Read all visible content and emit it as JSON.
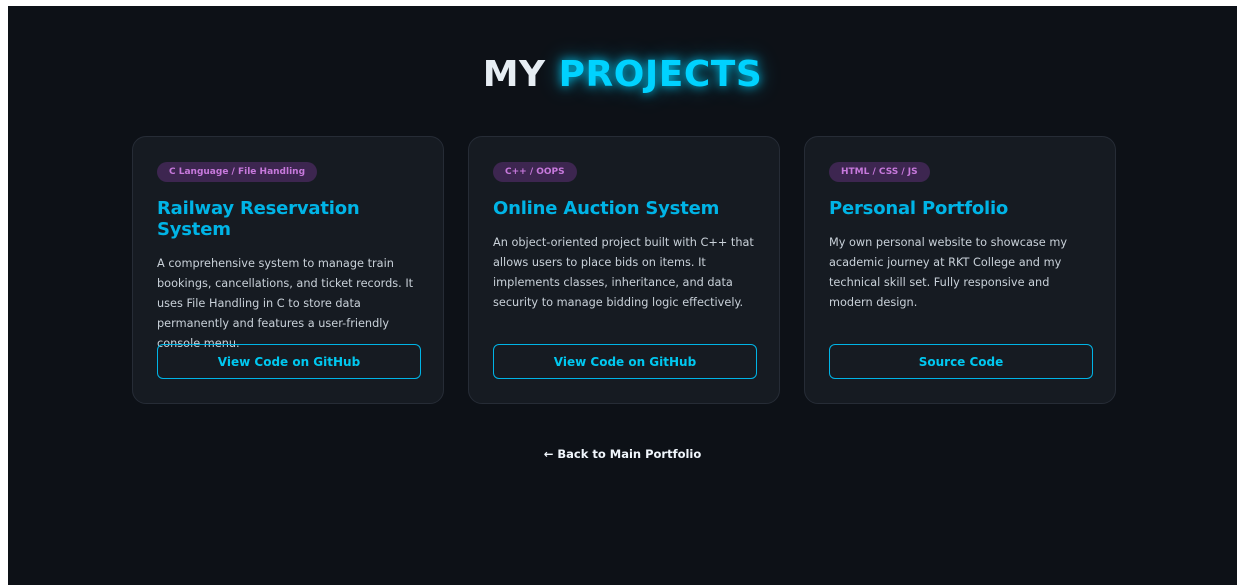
{
  "header": {
    "title_prefix": "MY",
    "title_accent": "PROJECTS"
  },
  "projects": [
    {
      "tag": "C Language / File Handling",
      "title": "Railway Reservation System",
      "description": "A comprehensive system to manage train bookings, cancellations, and ticket records. It uses File Handling in C to store data permanently and features a user-friendly console menu.",
      "button": "View Code on GitHub"
    },
    {
      "tag": "C++ / OOPS",
      "title": "Online Auction System",
      "description": "An object-oriented project built with C++ that allows users to place bids on items. It implements classes, inheritance, and data security to manage bidding logic effectively.",
      "button": "View Code on GitHub"
    },
    {
      "tag": "HTML / CSS / JS",
      "title": "Personal Portfolio",
      "description": "My own personal website to showcase my academic journey at RKT College and my technical skill set. Fully responsive and modern design.",
      "button": "Source Code"
    }
  ],
  "footer": {
    "back_link": "← Back to Main Portfolio"
  },
  "colors": {
    "background": "#0d1117",
    "card": "#161b22",
    "accent": "#00d2ff",
    "badge_bg": "#3d2650",
    "badge_text": "#c779dc"
  }
}
